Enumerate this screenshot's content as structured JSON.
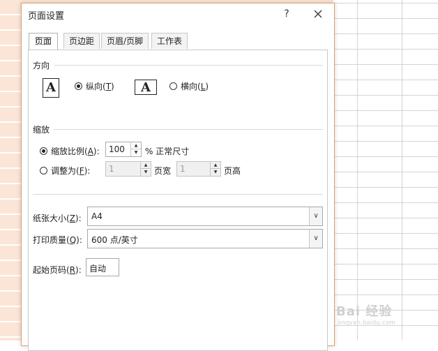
{
  "dialog": {
    "title": "页面设置",
    "help_label": "?",
    "close_icon": "close-icon"
  },
  "tabs": [
    {
      "label": "页面",
      "active": true
    },
    {
      "label": "页边距",
      "active": false
    },
    {
      "label": "页眉/页脚",
      "active": false
    },
    {
      "label": "工作表",
      "active": false
    }
  ],
  "orientation": {
    "section_label": "方向",
    "portrait_icon_text": "A",
    "landscape_icon_text": "A",
    "portrait_label": "纵向(",
    "portrait_key": "T",
    "portrait_suffix": ")",
    "landscape_label": "横向(",
    "landscape_key": "L",
    "landscape_suffix": ")",
    "selected": "portrait"
  },
  "scaling": {
    "section_label": "缩放",
    "scale_label": "缩放比例(",
    "scale_key": "A",
    "scale_suffix": "):",
    "scale_value": "100",
    "scale_unit": "% 正常尺寸",
    "fit_label": "调整为(",
    "fit_key": "F",
    "fit_suffix": "):",
    "fit_wide_value": "1",
    "fit_wide_label": "页宽",
    "fit_tall_value": "1",
    "fit_tall_label": "页高",
    "selected": "scale"
  },
  "paper": {
    "size_label": "纸张大小(",
    "size_key": "Z",
    "size_suffix": "):",
    "size_value": "A4",
    "quality_label": "打印质量(",
    "quality_key": "Q",
    "quality_suffix": "):",
    "quality_value": "600 点/英寸",
    "first_page_label": "起始页码(",
    "first_page_key": "R",
    "first_page_suffix": "):",
    "first_page_value": "自动"
  },
  "watermark": {
    "text": "Bai 经验",
    "sub": "jingyan.baidu.com"
  },
  "colors": {
    "sheet_highlight": "#fbe5d6",
    "dialog_border": "#e0a070"
  }
}
